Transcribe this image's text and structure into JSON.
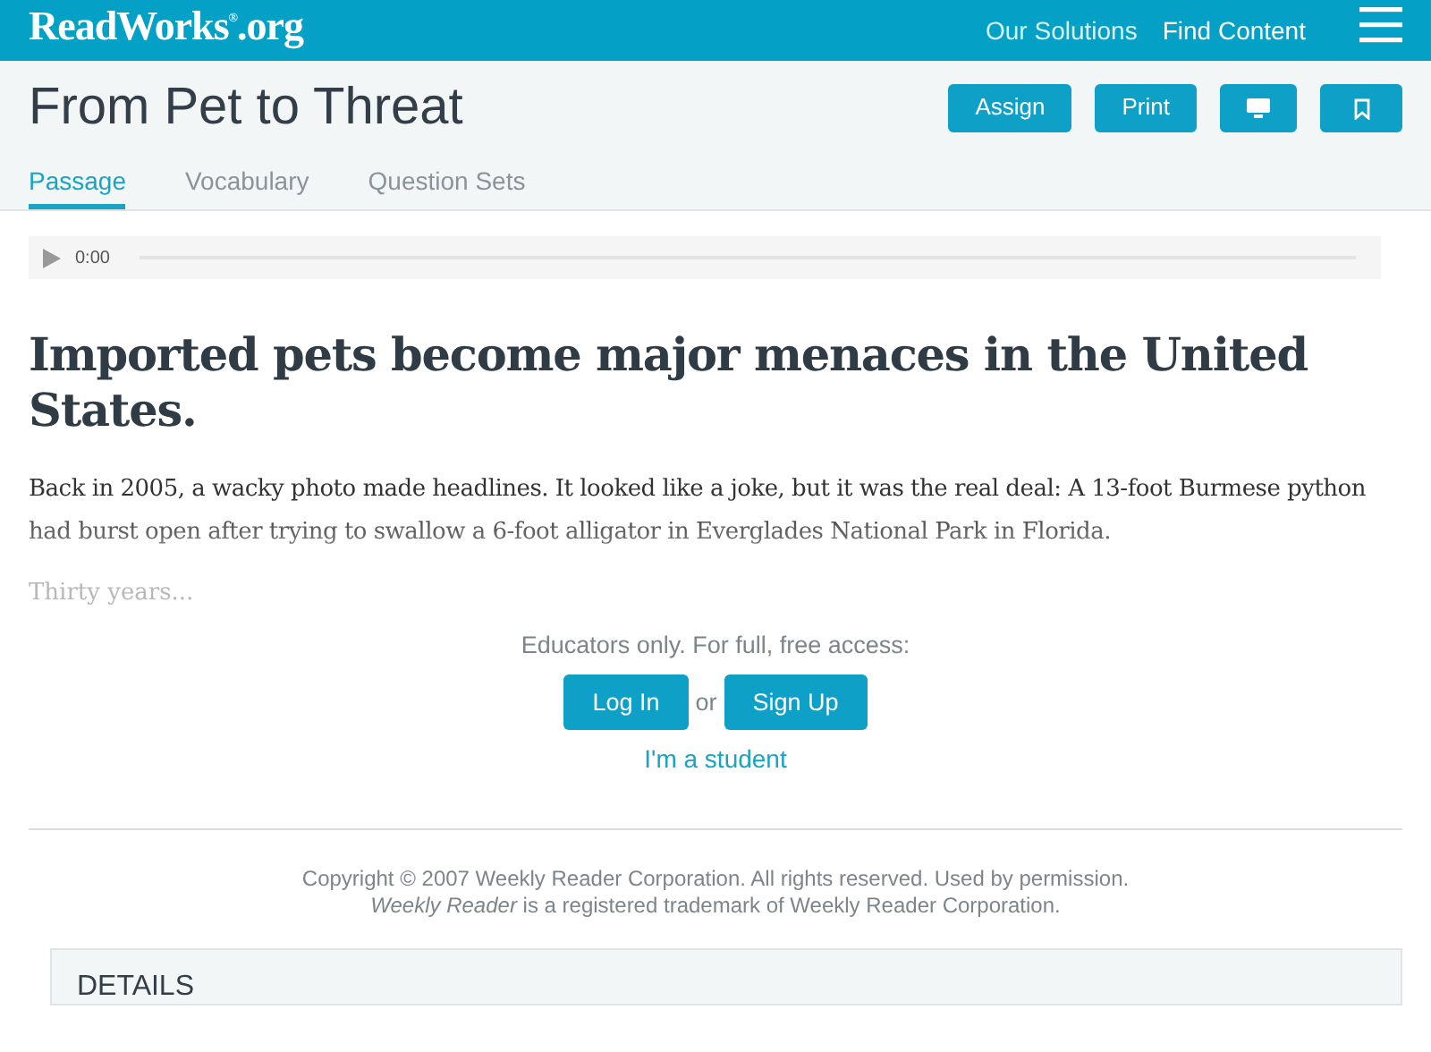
{
  "navbar": {
    "logo": "ReadWorks$^{®}$.org",
    "links": [
      "Our Solutions",
      "Find Content"
    ]
  },
  "header": {
    "title": "From Pet to Threat",
    "actions": [
      {
        "kind": "text",
        "label": "Assign"
      },
      {
        "kind": "text",
        "label": "Print"
      },
      {
        "kind": "monitor"
      },
      {
        "kind": "bookmark"
      }
    ],
    "tabs": [
      {
        "label": "Passage",
        "selected": true
      },
      {
        "label": "Vocabulary",
        "selected": false
      },
      {
        "label": "Question Sets",
        "selected": false
      }
    ]
  },
  "audio": {
    "time": "0:00"
  },
  "article": {
    "headline": "Imported pets become major menaces in the United States.",
    "paragraph": "Back in 2005, a wacky photo made headlines. It looked like a joke, but it was the real deal: A 13-foot Burmese python had burst open after trying to swallow a 6-foot alligator in Everglades National Park in Florida.",
    "teaser": "Thirty years..."
  },
  "access": {
    "prompt": "Educators only. For full, free access:",
    "login": "Log In",
    "or": "or",
    "signup": "Sign Up",
    "student": "I'm a student"
  },
  "copyright": [
    "Copyright © 2007 Weekly Reader Corporation. All rights reserved. Used by permission.",
    "*Weekly Reader* is a registered trademark of Weekly Reader Corporation."
  ],
  "details": {
    "title": "DETAILS"
  }
}
